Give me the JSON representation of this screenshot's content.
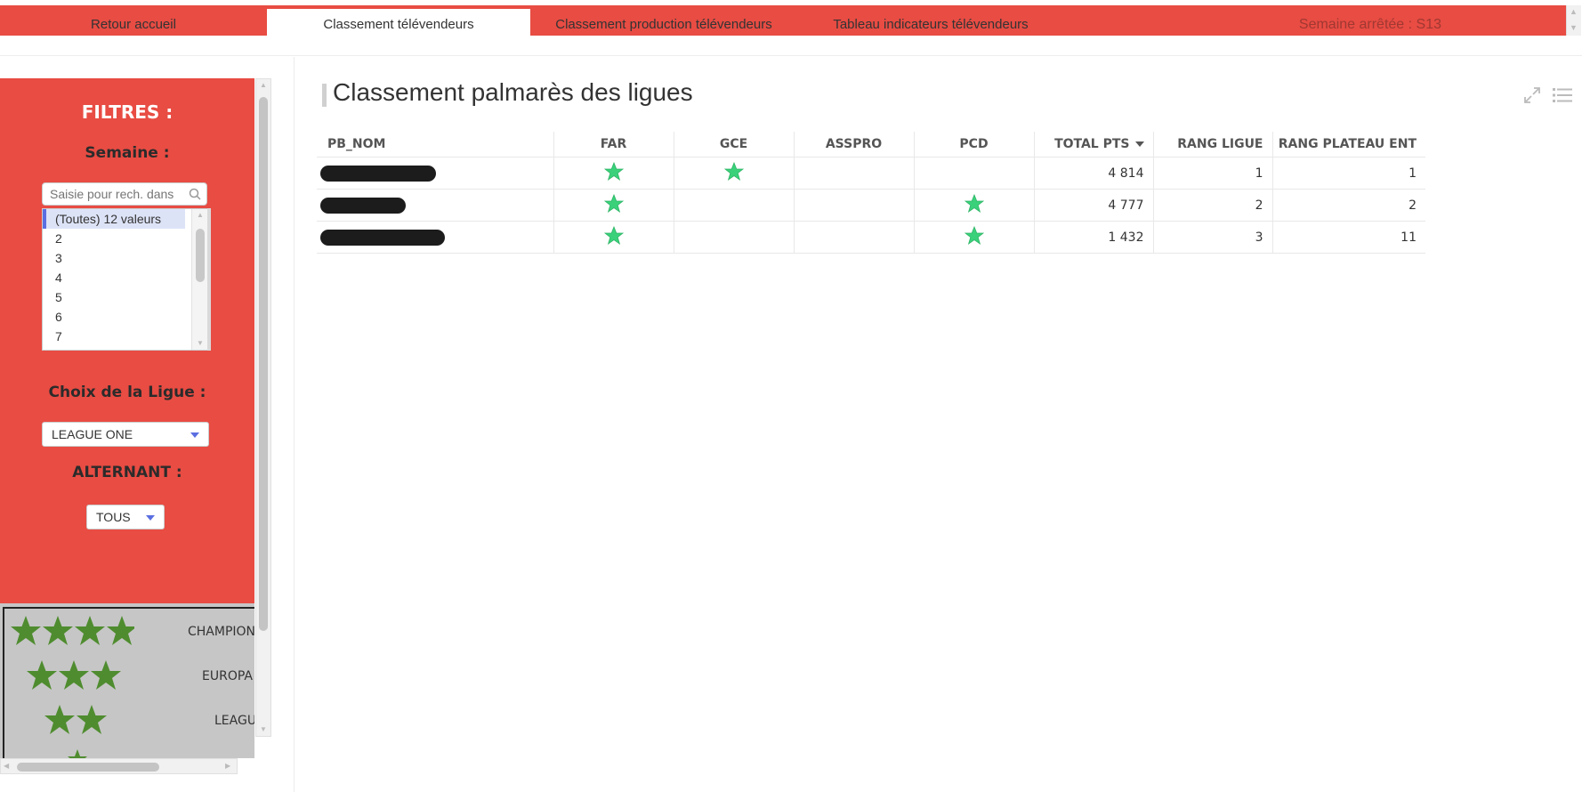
{
  "nav": {
    "tabs": [
      {
        "label": "Retour accueil",
        "active": false
      },
      {
        "label": "Classement télévendeurs",
        "active": true
      },
      {
        "label": "Classement production télévendeurs",
        "active": false
      },
      {
        "label": "Tableau indicateurs télévendeurs",
        "active": false
      }
    ],
    "week_label": "Semaine arrêtée : S13"
  },
  "filters": {
    "title": "FILTRES :",
    "semaine_label": "Semaine :",
    "search_placeholder": "Saisie pour rech. dans",
    "weeks": [
      "(Toutes) 12 valeurs",
      "2",
      "3",
      "4",
      "5",
      "6",
      "7"
    ],
    "selected_week": "(Toutes) 12 valeurs",
    "ligue_label": "Choix de la Ligue :",
    "ligue_value": "LEAGUE ONE",
    "alternant_label": "ALTERNANT :",
    "alternant_value": "TOUS"
  },
  "legend": [
    {
      "stars": 4,
      "label": "CHAMPION"
    },
    {
      "stars": 3,
      "label": "EUROPA L"
    },
    {
      "stars": 2,
      "label": "LEAGUE"
    }
  ],
  "colors": {
    "accent_red": "#e84c43",
    "star_green": "#3ad17a",
    "legend_star_green": "#4f8c2f"
  },
  "main": {
    "title": "Classement palmarès des ligues",
    "table": {
      "columns": [
        "PB_NOM",
        "FAR",
        "GCE",
        "ASSPRO",
        "PCD",
        "TOTAL PTS",
        "RANG LIGUE",
        "RANG PLATEAU ENT"
      ],
      "sorted_column": "TOTAL PTS",
      "rows": [
        {
          "name": "[masqué]",
          "far": true,
          "gce": true,
          "asspro": false,
          "pcd": false,
          "total": "4 814",
          "rang_ligue": "1",
          "rang_plateau": "1"
        },
        {
          "name": "[masqué]",
          "far": true,
          "gce": false,
          "asspro": false,
          "pcd": true,
          "total": "4 777",
          "rang_ligue": "2",
          "rang_plateau": "2"
        },
        {
          "name": "[masqué]",
          "far": true,
          "gce": false,
          "asspro": false,
          "pcd": true,
          "total": "1 432",
          "rang_ligue": "3",
          "rang_plateau": "11"
        }
      ]
    }
  }
}
